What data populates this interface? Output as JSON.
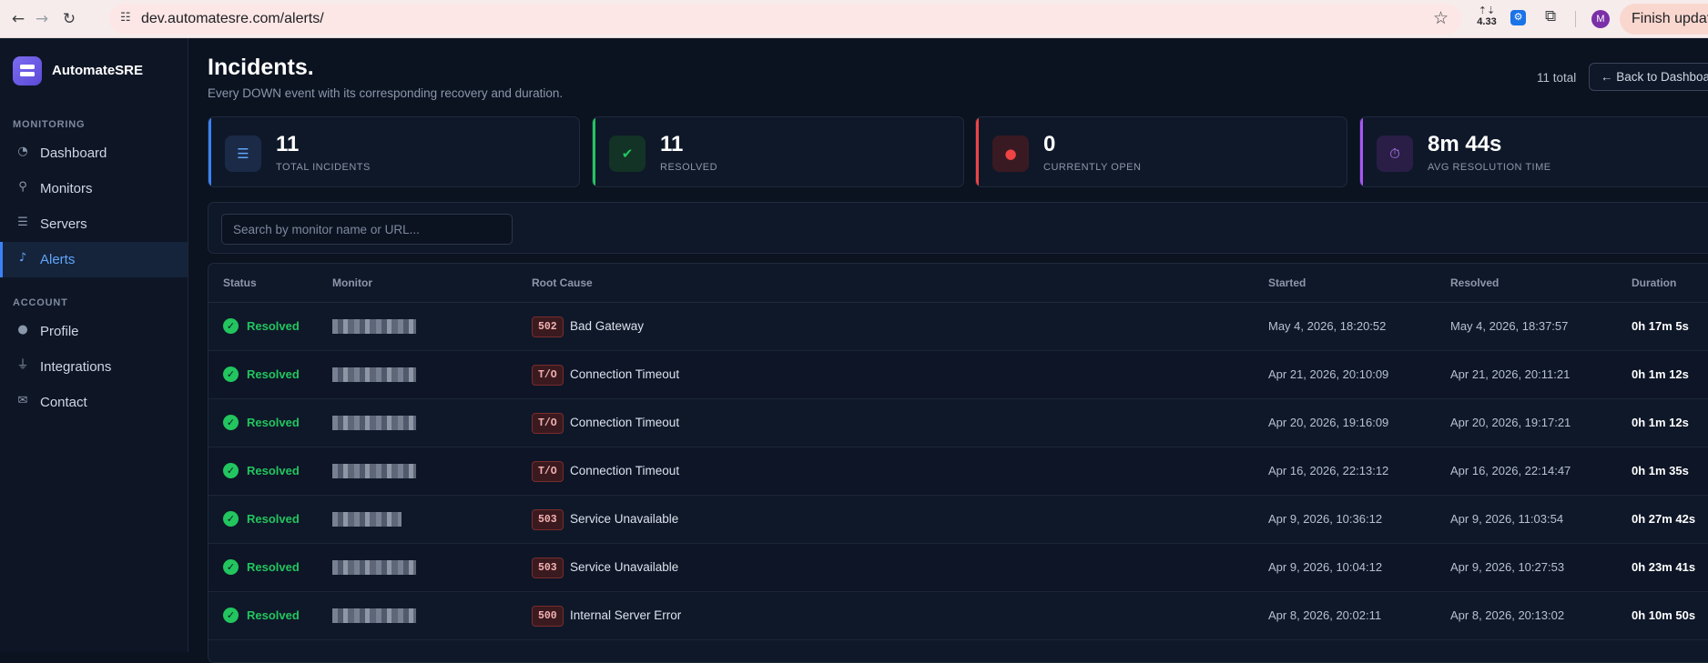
{
  "browser": {
    "url": "dev.automatesre.com/alerts/",
    "ext_badge": "4.33",
    "profile_initial": "M",
    "finish_update_label": "Finish update"
  },
  "sidebar": {
    "brand": "AutomateSRE",
    "sections": [
      {
        "label": "MONITORING",
        "items": [
          {
            "label": "Dashboard",
            "icon": "gauge-icon"
          },
          {
            "label": "Monitors",
            "icon": "satellite-icon"
          },
          {
            "label": "Servers",
            "icon": "server-icon"
          },
          {
            "label": "Alerts",
            "icon": "bell-icon",
            "active": true
          }
        ]
      },
      {
        "label": "ACCOUNT",
        "items": [
          {
            "label": "Profile",
            "icon": "user-icon"
          },
          {
            "label": "Integrations",
            "icon": "plug-icon"
          },
          {
            "label": "Contact",
            "icon": "envelope-icon"
          }
        ]
      }
    ]
  },
  "header": {
    "title": "Incidents.",
    "subtitle": "Every DOWN event with its corresponding recovery and duration.",
    "total": "11 total",
    "back_label": "← Back to Dashboard"
  },
  "stats": [
    {
      "value": "11",
      "label": "TOTAL INCIDENTS",
      "icon": "list-icon",
      "accent": "#3b82f6"
    },
    {
      "value": "11",
      "label": "RESOLVED",
      "icon": "check-circle-icon",
      "accent": "#22c55e"
    },
    {
      "value": "0",
      "label": "CURRENTLY OPEN",
      "icon": "alert-icon",
      "accent": "#ef4444"
    },
    {
      "value": "8m 44s",
      "label": "AVG RESOLUTION TIME",
      "icon": "stopwatch-icon",
      "accent": "#a855f7"
    }
  ],
  "search": {
    "placeholder": "Search by monitor name or URL...",
    "value": ""
  },
  "table": {
    "columns": [
      "Status",
      "Monitor",
      "Root Cause",
      "Started",
      "Resolved",
      "Duration"
    ],
    "rows": [
      {
        "status": "Resolved",
        "code": "502",
        "cause": "Bad Gateway",
        "started": "May 4, 2026, 18:20:52",
        "resolved": "May 4, 2026, 18:37:57",
        "duration": "0h 17m 5s"
      },
      {
        "status": "Resolved",
        "code": "T/O",
        "cause": "Connection Timeout",
        "started": "Apr 21, 2026, 20:10:09",
        "resolved": "Apr 21, 2026, 20:11:21",
        "duration": "0h 1m 12s"
      },
      {
        "status": "Resolved",
        "code": "T/O",
        "cause": "Connection Timeout",
        "started": "Apr 20, 2026, 19:16:09",
        "resolved": "Apr 20, 2026, 19:17:21",
        "duration": "0h 1m 12s"
      },
      {
        "status": "Resolved",
        "code": "T/O",
        "cause": "Connection Timeout",
        "started": "Apr 16, 2026, 22:13:12",
        "resolved": "Apr 16, 2026, 22:14:47",
        "duration": "0h 1m 35s"
      },
      {
        "status": "Resolved",
        "code": "503",
        "cause": "Service Unavailable",
        "started": "Apr 9, 2026, 10:36:12",
        "resolved": "Apr 9, 2026, 11:03:54",
        "duration": "0h 27m 42s"
      },
      {
        "status": "Resolved",
        "code": "503",
        "cause": "Service Unavailable",
        "started": "Apr 9, 2026, 10:04:12",
        "resolved": "Apr 9, 2026, 10:27:53",
        "duration": "0h 23m 41s"
      },
      {
        "status": "Resolved",
        "code": "500",
        "cause": "Internal Server Error",
        "started": "Apr 8, 2026, 20:02:11",
        "resolved": "Apr 8, 2026, 20:13:02",
        "duration": "0h 10m 50s"
      }
    ]
  }
}
